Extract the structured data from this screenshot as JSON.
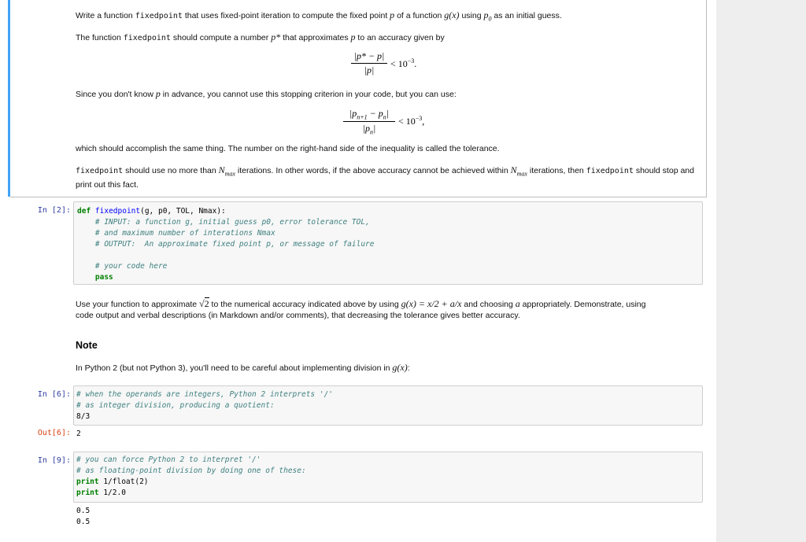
{
  "intro": {
    "p1_a": "Write a function",
    "p1_code": "fixedpoint",
    "p1_b": "that uses fixed-point iteration to compute the fixed point",
    "p1_p": "p",
    "p1_c": "of a function",
    "p1_g": "g(x)",
    "p1_d": "using",
    "p1_p0": "p",
    "p1_p0_sub": "0",
    "p1_e": "as an initial guess.",
    "p2_a": "The function",
    "p2_code": "fixedpoint",
    "p2_b": "should compute a number",
    "p2_pstar": "p*",
    "p2_c": "that approximates",
    "p2_p": "p",
    "p2_d": "to an accuracy given by",
    "eq1_num": "|p* − p|",
    "eq1_den": "|p|",
    "eq1_rhs": "< 10",
    "eq1_exp": "−3",
    "eq1_end": ".",
    "p3": "Since you don't know",
    "p3_p": "p",
    "p3_b": "in advance, you cannot use this stopping criterion in your code, but you can use:",
    "eq2_num": "|p",
    "eq2_num_sub": "n+1",
    "eq2_num_b": " − p",
    "eq2_num_sub2": "n",
    "eq2_num_c": "|",
    "eq2_den": "|p",
    "eq2_den_sub": "n",
    "eq2_den_b": "|",
    "eq2_rhs": "< 10",
    "eq2_exp": "−3",
    "eq2_end": ",",
    "p4": "which should accomplish the same thing. The number on the right-hand side of the inequality is called the tolerance.",
    "p5_code": "fixedpoint",
    "p5_a": "should use no more than",
    "p5_N": "N",
    "p5_Nsub": "max",
    "p5_b": "iterations. In other words, if the above accuracy cannot be achieved within",
    "p5_N2": "N",
    "p5_N2sub": "max",
    "p5_c": "iterations, then",
    "p5_code2": "fixedpoint",
    "p5_d": "should stop and print out this fact."
  },
  "cell2": {
    "prompt": "In [2]:",
    "line1_kw": "def",
    "line1_fn": "fixedpoint",
    "line1_rest": "(g, p0, TOL, Nmax):",
    "line2": "    # INPUT: a function g, initial guess p0, error tolerance TOL,",
    "line3": "    # and maximum number of interations Nmax",
    "line4": "    # OUTPUT:  An approximate fixed point p, or message of failure",
    "line5": "    # your code here",
    "line6_indent": "    ",
    "line6_kw": "pass"
  },
  "md2": {
    "a": "Use your function to approximate",
    "sqrt": "2",
    "b": "to the numerical accuracy indicated above by using",
    "g": "g(x) = x/2 + a/x",
    "c": "and choosing",
    "aa": "a",
    "d": "appropriately. Demonstrate, using",
    "line2": "code output and verbal descriptions (in Markdown and/or comments), that decreasing the tolerance gives better accuracy."
  },
  "note": {
    "heading": "Note",
    "text": "In Python 2 (but not Python 3), you'll need to be careful about implementing division in",
    "gx": "g(x)",
    "colon": ":"
  },
  "cell6": {
    "prompt": "In [6]:",
    "line1": "# when the operands are integers, Python 2 interprets '/'",
    "line2": "# as integer division, producing a quotient:",
    "line3": "8/3",
    "out_prompt": "Out[6]:",
    "out": "2"
  },
  "cell9": {
    "prompt": "In [9]:",
    "line1": "# you can force Python 2 to interpret '/'",
    "line2": "# as floating-point division by doing one of these:",
    "line3_kw": "print",
    "line3_rest": " 1/float(2)",
    "line4_kw": "print",
    "line4_rest": " 1/2.0",
    "out1": "0.5",
    "out2": "0.5"
  }
}
